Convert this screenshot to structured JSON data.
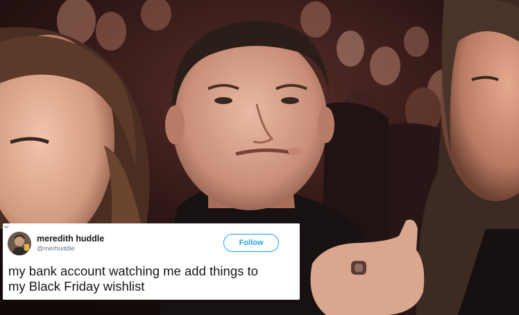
{
  "photo": {
    "description_icon": "audience-photo"
  },
  "tweet": {
    "display_name": "meredith huddle",
    "handle": "@merhuddle",
    "follow_label": "Follow",
    "text": "my bank account watching me add things to\nmy Black Friday wishlist",
    "accent_color": "#1da1f2"
  }
}
